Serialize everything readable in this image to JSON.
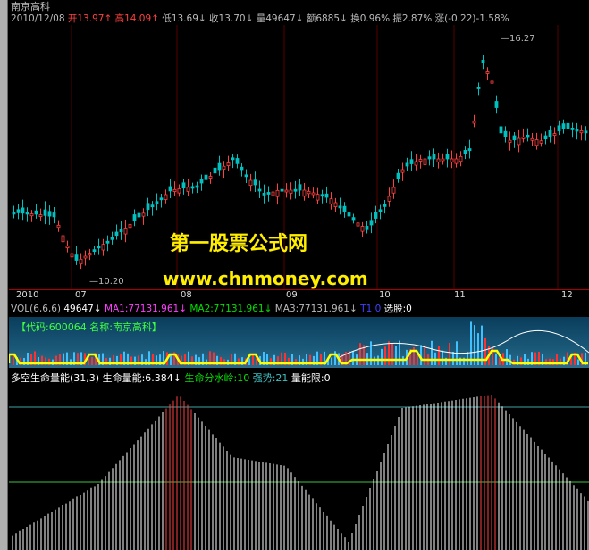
{
  "stock_name": "南京高科",
  "quote": {
    "date": "2010/12/08",
    "open_label": "开",
    "open": "13.97",
    "high_label": "高",
    "high": "14.09",
    "low_label": "低",
    "low": "13.69",
    "close_label": "收",
    "close": "13.70",
    "volume_label": "量",
    "volume": "49647",
    "amount_label": "额",
    "amount": "6885",
    "turnover_label": "换",
    "turnover": "0.96%",
    "amplitude_label": "振",
    "amplitude": "2.87%",
    "change_label": "涨",
    "change": "(-0.22)-1.58%",
    "arrow_up": "↑",
    "arrow_down": "↓"
  },
  "price_marks": {
    "high_mark": "16.27",
    "low_mark": "10.20"
  },
  "time_axis": [
    "2010",
    "07",
    "08",
    "09",
    "10",
    "11",
    "12"
  ],
  "watermark": {
    "line1": "第一股票公式网",
    "line2": "www.chnmoney.com"
  },
  "vol_bar": {
    "title": "VOL(6,6,6)",
    "vol": "49647",
    "ma1": "MA1:77131.961",
    "ma2": "MA2:77131.961",
    "ma3": "MA3:77131.961",
    "t1": "T1",
    "t1_value": "0",
    "pick": "选股:0",
    "colors": {
      "ma1": "#ff40ff",
      "ma2": "#00e000",
      "ma3": "#cccccc"
    }
  },
  "info_panel": {
    "code_label": "【代码:600064  名称:南京高科】"
  },
  "energy": {
    "title": "多空生命量能(31,3)",
    "life_energy": "生命量能:6.384",
    "divide_line": "生命分水岭:10",
    "strength": "强势:21",
    "limit": "量能限:0"
  },
  "colors": {
    "up": "#ff4040",
    "down": "#00c0c0",
    "accent": "#ffee00"
  }
}
